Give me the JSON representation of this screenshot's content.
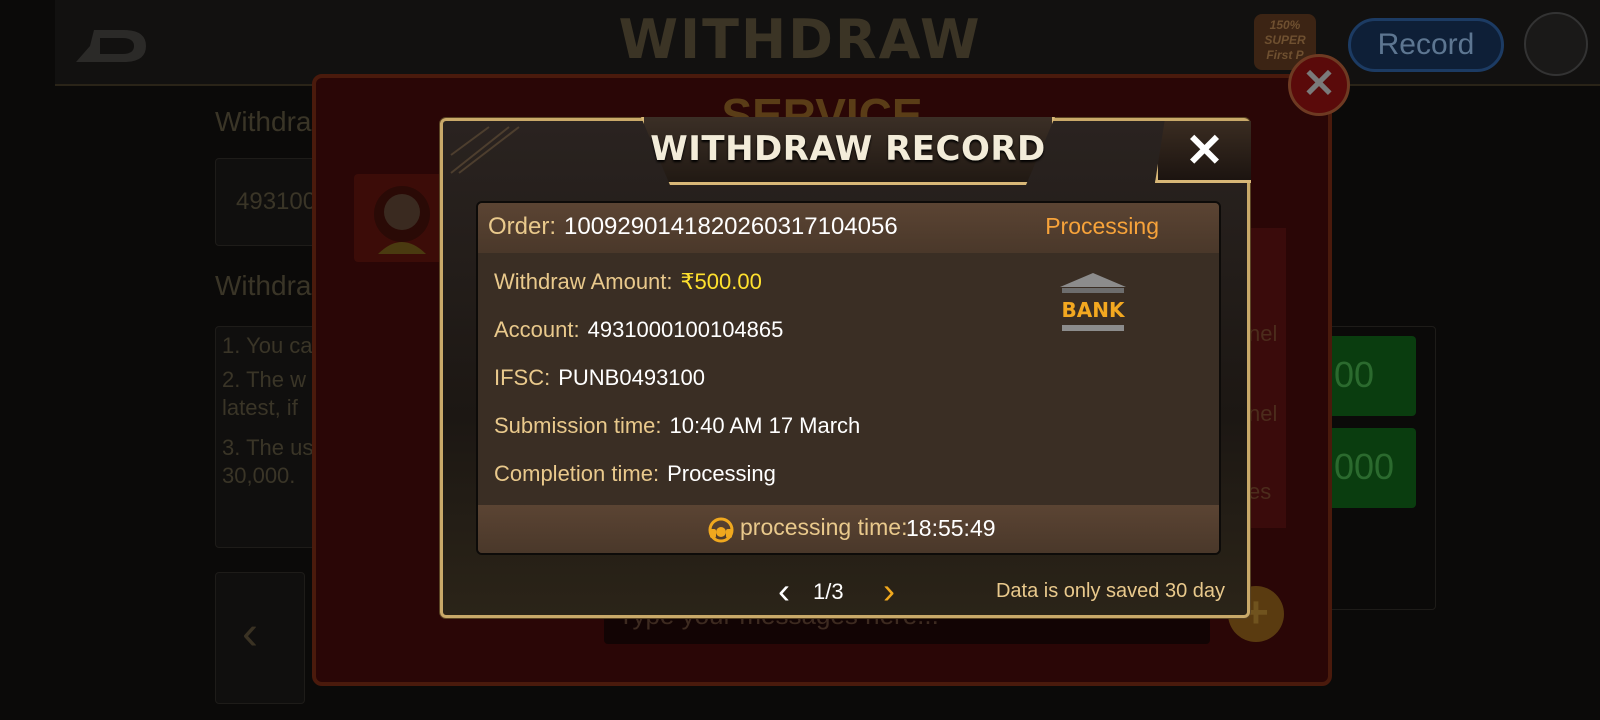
{
  "background": {
    "page_title": "WITHDRAW",
    "promo_badge": "150% SUPER First P",
    "record_button": "Record",
    "withdraw_label_1": "Withdra",
    "account_partial": "493100",
    "withdraw_label_2": "Withdra",
    "rules": [
      "1. You ca",
      "2. The w",
      "latest, if",
      "3. The us",
      "30,000."
    ],
    "green_btn_1": "00",
    "green_btn_2": "000",
    "side_links": [
      "nel",
      "nel",
      "es"
    ]
  },
  "service": {
    "title": "SERVICE",
    "message_placeholder": "Type your messages here..."
  },
  "modal": {
    "title": "WITHDRAW RECORD",
    "close_label": "✕",
    "order": {
      "label": "Order:",
      "value": "1009290141820260317104056",
      "status": "Processing"
    },
    "details": [
      {
        "label": "Withdraw Amount:",
        "value": "₹500.00"
      },
      {
        "label": "Account:",
        "value": "4931000100104865"
      },
      {
        "label": "IFSC:",
        "value": "PUNB0493100"
      },
      {
        "label": "Submission time:",
        "value": "10:40 AM 17 March"
      },
      {
        "label": "Completion time:",
        "value": "Processing"
      }
    ],
    "bank_label": "BANK",
    "processing": {
      "label": "processing time:",
      "value": "18:55:49"
    },
    "pager": {
      "text": "1/3"
    },
    "note": "Data is only saved 30 day"
  },
  "colors": {
    "gold_label": "#e9c98c",
    "amount_yellow": "#ffe12e",
    "status_orange": "#f7a33a",
    "frame_gold": "#c9a969"
  }
}
